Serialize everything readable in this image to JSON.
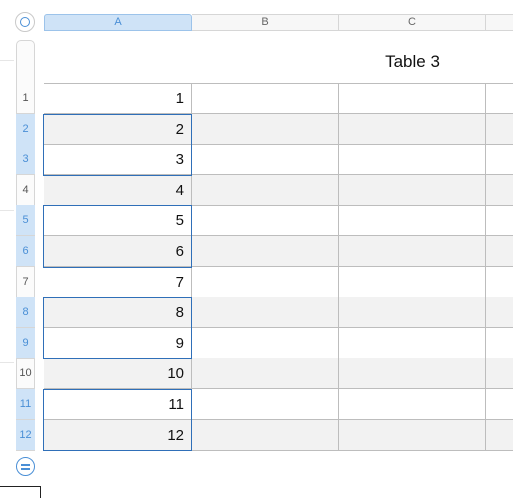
{
  "table": {
    "title": "Table 3",
    "columns": [
      "A",
      "B",
      "C"
    ],
    "selected_column": "A",
    "rows": [
      {
        "num": "1",
        "a": "1",
        "selected": false
      },
      {
        "num": "2",
        "a": "2",
        "selected": true
      },
      {
        "num": "3",
        "a": "3",
        "selected": true
      },
      {
        "num": "4",
        "a": "4",
        "selected": false
      },
      {
        "num": "5",
        "a": "5",
        "selected": true
      },
      {
        "num": "6",
        "a": "6",
        "selected": true
      },
      {
        "num": "7",
        "a": "7",
        "selected": false
      },
      {
        "num": "8",
        "a": "8",
        "selected": true
      },
      {
        "num": "9",
        "a": "9",
        "selected": true
      },
      {
        "num": "10",
        "a": "10",
        "selected": false
      },
      {
        "num": "11",
        "a": "11",
        "selected": true
      },
      {
        "num": "12",
        "a": "12",
        "selected": true
      }
    ]
  },
  "colors": {
    "selection_border": "#2f6fb8",
    "header_selected_bg": "#cfe3f7",
    "header_selected_text": "#4a8fd6",
    "alt_row_bg": "#f2f2f2"
  },
  "icons": {
    "top_left": "table-select-circle-icon",
    "bottom": "add-rows-equals-icon"
  }
}
